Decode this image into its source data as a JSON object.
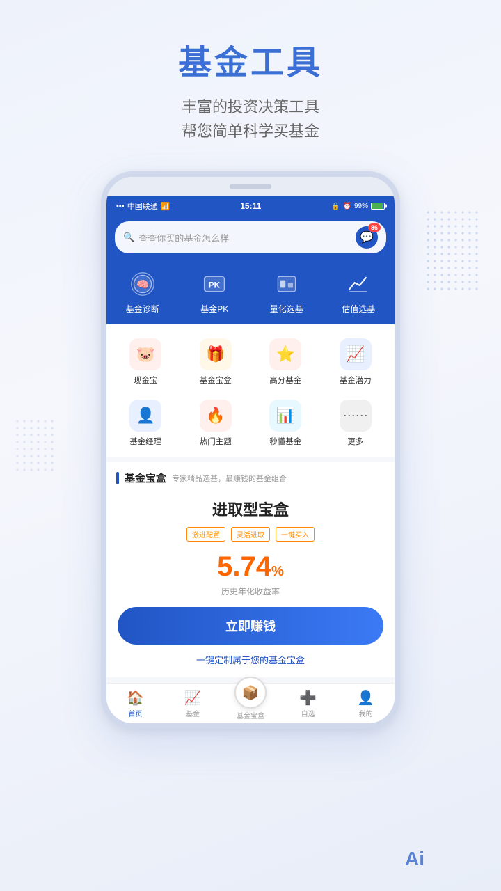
{
  "page": {
    "title": "基金工具",
    "subtitle_line1": "丰富的投资决策工具",
    "subtitle_line2": "帮您简单科学买基金"
  },
  "status_bar": {
    "carrier": "中国联通",
    "time": "15:11",
    "battery": "99%"
  },
  "search": {
    "placeholder": "查查你买的基金怎么样",
    "badge": "86"
  },
  "top_tools": [
    {
      "label": "基金诊断",
      "icon": "brain"
    },
    {
      "label": "基金PK",
      "icon": "pk"
    },
    {
      "label": "量化选基",
      "icon": "quant"
    },
    {
      "label": "估值选基",
      "icon": "chart"
    }
  ],
  "features": [
    {
      "label": "现金宝",
      "icon": "🐷",
      "color": "#fff0ee"
    },
    {
      "label": "基金宝盒",
      "icon": "🎁",
      "color": "#fff8e8"
    },
    {
      "label": "高分基金",
      "icon": "⭐",
      "color": "#fff0ee"
    },
    {
      "label": "基金潜力",
      "icon": "📈",
      "color": "#e8f0ff"
    },
    {
      "label": "基金经理",
      "icon": "👤",
      "color": "#e8f0ff"
    },
    {
      "label": "热门主题",
      "icon": "🔥",
      "color": "#fff0ee"
    },
    {
      "label": "秒懂基金",
      "icon": "📊",
      "color": "#e8f8ff"
    },
    {
      "label": "更多",
      "icon": "⋯",
      "color": "#f0f0f0"
    }
  ],
  "section": {
    "title": "基金宝盒",
    "subtitle": "专家精品选基，最赚钱的基金组合"
  },
  "card": {
    "title": "进取型宝盒",
    "tags": [
      "激进配置",
      "灵活进取",
      "一键买入"
    ],
    "rate": "5.74",
    "rate_unit": "%",
    "rate_label": "历史年化收益率",
    "cta": "立即赚钱",
    "customize": "一键定制属于您的基金宝盒"
  },
  "bottom_nav": [
    {
      "label": "首页",
      "icon": "🏠",
      "active": true
    },
    {
      "label": "基金",
      "icon": "📈",
      "active": false
    },
    {
      "label": "基金宝盒",
      "icon": "📦",
      "active": false,
      "center": true
    },
    {
      "label": "自选",
      "icon": "➕",
      "active": false
    },
    {
      "label": "我的",
      "icon": "👤",
      "active": false
    }
  ],
  "ai_label": "Ai"
}
